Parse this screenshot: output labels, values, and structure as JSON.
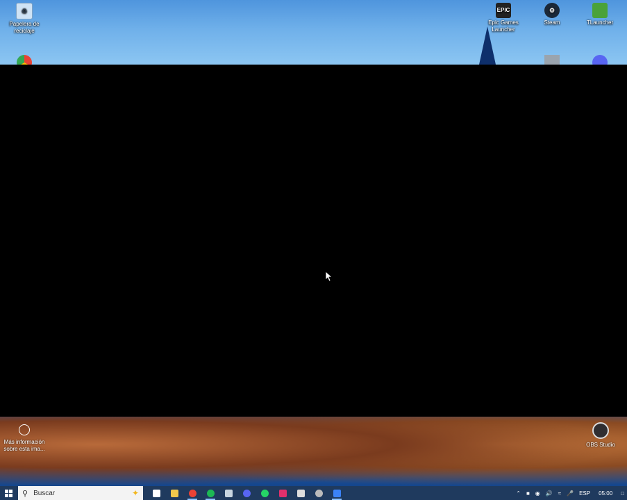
{
  "desktop": {
    "top_icons": [
      {
        "label": "Papelera de reciclaje",
        "icon": "recycle-bin-icon"
      },
      {
        "label": "Epic Games Launcher",
        "icon": "epic-games-icon",
        "glyph": "EPIC"
      },
      {
        "label": "Steam",
        "icon": "steam-icon"
      },
      {
        "label": "TLauncher",
        "icon": "tlauncher-icon"
      }
    ],
    "info": {
      "label": "Más información sobre esta ima...",
      "icon": "info-icon"
    },
    "obs": {
      "label": "OBS Studio",
      "icon": "obs-studio-icon"
    }
  },
  "taskbar": {
    "search_placeholder": "Buscar",
    "apps": [
      {
        "name": "task-view-icon",
        "color": "#ffffff"
      },
      {
        "name": "file-explorer-icon",
        "color": "#f2c94c"
      },
      {
        "name": "chrome-icon",
        "color": "#ea4335"
      },
      {
        "name": "spotify-icon",
        "color": "#1db954"
      },
      {
        "name": "steam-icon",
        "color": "#c7d5e0"
      },
      {
        "name": "discord-icon",
        "color": "#5865f2"
      },
      {
        "name": "whatsapp-icon",
        "color": "#25d366"
      },
      {
        "name": "instagram-icon",
        "color": "#e1306c"
      },
      {
        "name": "epic-games-icon",
        "color": "#dddddd"
      },
      {
        "name": "obs-icon",
        "color": "#bbbbbb"
      },
      {
        "name": "roblox-studio-icon",
        "color": "#3b82f6"
      }
    ],
    "tray": {
      "language": "ESP",
      "time": "05:00"
    }
  }
}
